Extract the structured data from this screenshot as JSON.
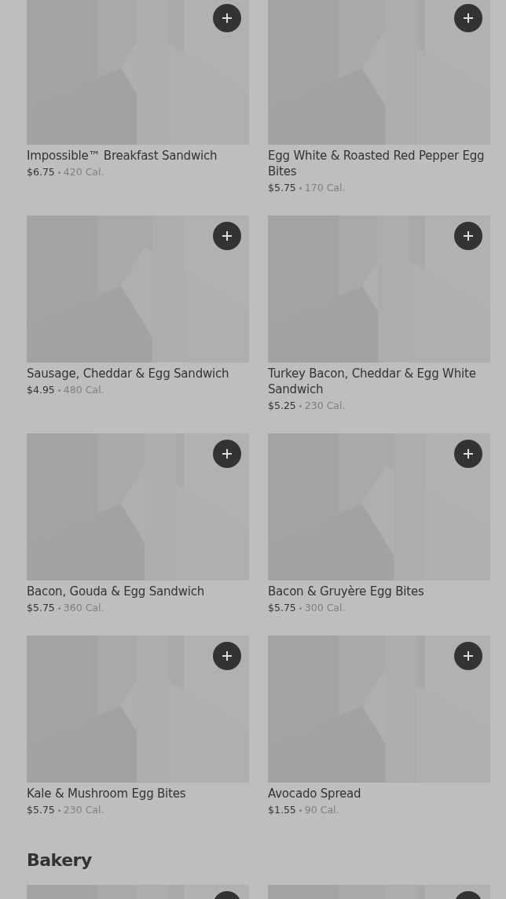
{
  "sections": [
    {
      "items": [
        {
          "kind": "product",
          "name": "Impossible™ Breakfast Sandwich",
          "price": "$6.75",
          "calories": "420 Cal."
        },
        {
          "kind": "product",
          "name": "Egg White & Roasted Red Pepper Egg Bites",
          "price": "$5.75",
          "calories": "170 Cal."
        },
        {
          "kind": "product",
          "name": "Sausage, Cheddar & Egg Sandwich",
          "price": "$4.95",
          "calories": "480 Cal."
        },
        {
          "kind": "product",
          "name": "Turkey Bacon, Cheddar & Egg White Sandwich",
          "price": "$5.25",
          "calories": "230 Cal."
        },
        {
          "kind": "product",
          "name": "Bacon, Gouda & Egg Sandwich",
          "price": "$5.75",
          "calories": "360 Cal."
        },
        {
          "kind": "product",
          "name": "Bacon & Gruyère Egg Bites",
          "price": "$5.75",
          "calories": "300 Cal."
        },
        {
          "kind": "product",
          "name": "Kale & Mushroom Egg Bites",
          "price": "$5.75",
          "calories": "230 Cal."
        },
        {
          "kind": "product",
          "name": "Avocado Spread",
          "price": "$1.55",
          "calories": "90 Cal."
        }
      ]
    },
    {
      "title": "Bakery"
    }
  ]
}
